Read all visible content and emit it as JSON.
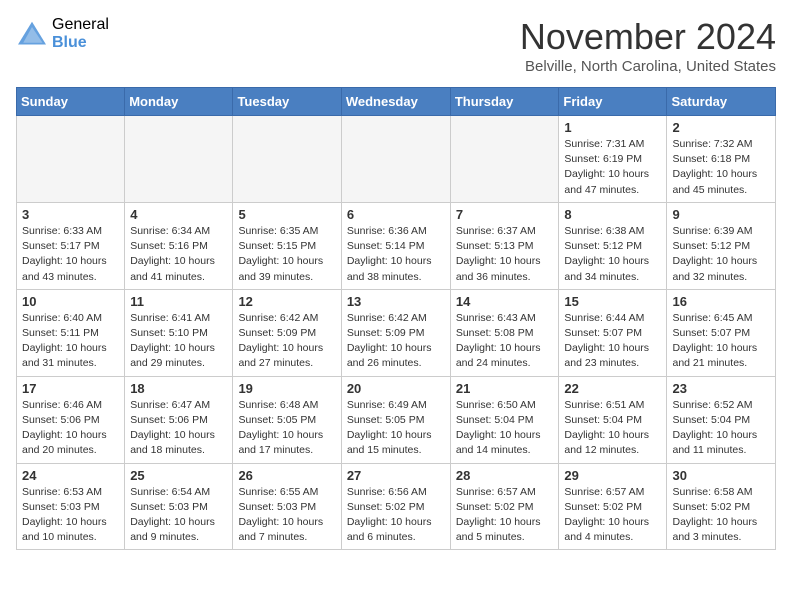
{
  "header": {
    "logo_general": "General",
    "logo_blue": "Blue",
    "month_title": "November 2024",
    "location": "Belville, North Carolina, United States"
  },
  "days_of_week": [
    "Sunday",
    "Monday",
    "Tuesday",
    "Wednesday",
    "Thursday",
    "Friday",
    "Saturday"
  ],
  "weeks": [
    [
      {
        "day": "",
        "info": ""
      },
      {
        "day": "",
        "info": ""
      },
      {
        "day": "",
        "info": ""
      },
      {
        "day": "",
        "info": ""
      },
      {
        "day": "",
        "info": ""
      },
      {
        "day": "1",
        "info": "Sunrise: 7:31 AM\nSunset: 6:19 PM\nDaylight: 10 hours and 47 minutes."
      },
      {
        "day": "2",
        "info": "Sunrise: 7:32 AM\nSunset: 6:18 PM\nDaylight: 10 hours and 45 minutes."
      }
    ],
    [
      {
        "day": "3",
        "info": "Sunrise: 6:33 AM\nSunset: 5:17 PM\nDaylight: 10 hours and 43 minutes."
      },
      {
        "day": "4",
        "info": "Sunrise: 6:34 AM\nSunset: 5:16 PM\nDaylight: 10 hours and 41 minutes."
      },
      {
        "day": "5",
        "info": "Sunrise: 6:35 AM\nSunset: 5:15 PM\nDaylight: 10 hours and 39 minutes."
      },
      {
        "day": "6",
        "info": "Sunrise: 6:36 AM\nSunset: 5:14 PM\nDaylight: 10 hours and 38 minutes."
      },
      {
        "day": "7",
        "info": "Sunrise: 6:37 AM\nSunset: 5:13 PM\nDaylight: 10 hours and 36 minutes."
      },
      {
        "day": "8",
        "info": "Sunrise: 6:38 AM\nSunset: 5:12 PM\nDaylight: 10 hours and 34 minutes."
      },
      {
        "day": "9",
        "info": "Sunrise: 6:39 AM\nSunset: 5:12 PM\nDaylight: 10 hours and 32 minutes."
      }
    ],
    [
      {
        "day": "10",
        "info": "Sunrise: 6:40 AM\nSunset: 5:11 PM\nDaylight: 10 hours and 31 minutes."
      },
      {
        "day": "11",
        "info": "Sunrise: 6:41 AM\nSunset: 5:10 PM\nDaylight: 10 hours and 29 minutes."
      },
      {
        "day": "12",
        "info": "Sunrise: 6:42 AM\nSunset: 5:09 PM\nDaylight: 10 hours and 27 minutes."
      },
      {
        "day": "13",
        "info": "Sunrise: 6:42 AM\nSunset: 5:09 PM\nDaylight: 10 hours and 26 minutes."
      },
      {
        "day": "14",
        "info": "Sunrise: 6:43 AM\nSunset: 5:08 PM\nDaylight: 10 hours and 24 minutes."
      },
      {
        "day": "15",
        "info": "Sunrise: 6:44 AM\nSunset: 5:07 PM\nDaylight: 10 hours and 23 minutes."
      },
      {
        "day": "16",
        "info": "Sunrise: 6:45 AM\nSunset: 5:07 PM\nDaylight: 10 hours and 21 minutes."
      }
    ],
    [
      {
        "day": "17",
        "info": "Sunrise: 6:46 AM\nSunset: 5:06 PM\nDaylight: 10 hours and 20 minutes."
      },
      {
        "day": "18",
        "info": "Sunrise: 6:47 AM\nSunset: 5:06 PM\nDaylight: 10 hours and 18 minutes."
      },
      {
        "day": "19",
        "info": "Sunrise: 6:48 AM\nSunset: 5:05 PM\nDaylight: 10 hours and 17 minutes."
      },
      {
        "day": "20",
        "info": "Sunrise: 6:49 AM\nSunset: 5:05 PM\nDaylight: 10 hours and 15 minutes."
      },
      {
        "day": "21",
        "info": "Sunrise: 6:50 AM\nSunset: 5:04 PM\nDaylight: 10 hours and 14 minutes."
      },
      {
        "day": "22",
        "info": "Sunrise: 6:51 AM\nSunset: 5:04 PM\nDaylight: 10 hours and 12 minutes."
      },
      {
        "day": "23",
        "info": "Sunrise: 6:52 AM\nSunset: 5:04 PM\nDaylight: 10 hours and 11 minutes."
      }
    ],
    [
      {
        "day": "24",
        "info": "Sunrise: 6:53 AM\nSunset: 5:03 PM\nDaylight: 10 hours and 10 minutes."
      },
      {
        "day": "25",
        "info": "Sunrise: 6:54 AM\nSunset: 5:03 PM\nDaylight: 10 hours and 9 minutes."
      },
      {
        "day": "26",
        "info": "Sunrise: 6:55 AM\nSunset: 5:03 PM\nDaylight: 10 hours and 7 minutes."
      },
      {
        "day": "27",
        "info": "Sunrise: 6:56 AM\nSunset: 5:02 PM\nDaylight: 10 hours and 6 minutes."
      },
      {
        "day": "28",
        "info": "Sunrise: 6:57 AM\nSunset: 5:02 PM\nDaylight: 10 hours and 5 minutes."
      },
      {
        "day": "29",
        "info": "Sunrise: 6:57 AM\nSunset: 5:02 PM\nDaylight: 10 hours and 4 minutes."
      },
      {
        "day": "30",
        "info": "Sunrise: 6:58 AM\nSunset: 5:02 PM\nDaylight: 10 hours and 3 minutes."
      }
    ]
  ]
}
